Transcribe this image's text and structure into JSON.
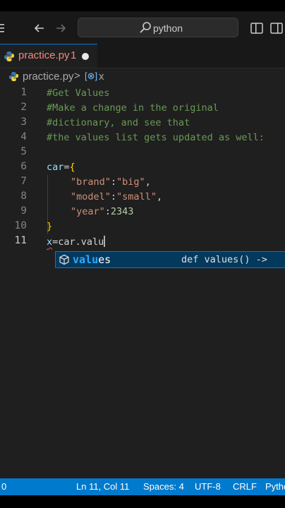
{
  "window": {
    "search_text": "python"
  },
  "tabs": [
    {
      "name": "practice.py",
      "problems": "1"
    }
  ],
  "breadcrumb": {
    "file": "practice.py",
    "separator": ">",
    "symbol_icon": "[⊗]",
    "symbol": "x"
  },
  "editor": {
    "line_numbers": [
      "1",
      "2",
      "3",
      "4",
      "5",
      "6",
      "7",
      "8",
      "9",
      "10",
      "11"
    ],
    "lines": {
      "l1": "#Get Values",
      "l2": "#Make a change in the original",
      "l3": "#dictionary, and see that",
      "l4": "#the values list gets updated as well:",
      "l6_var": "car",
      "l6_eq": "=",
      "l6_brace": "{",
      "l7_key": "\"brand\"",
      "l7_colon": ":",
      "l7_val": "\"big\"",
      "l7_comma": ",",
      "l8_key": "\"model\"",
      "l8_colon": ":",
      "l8_val": "\"small\"",
      "l8_comma": ",",
      "l9_key": "\"year\"",
      "l9_colon": ":",
      "l9_val": "2343",
      "l10_brace": "}",
      "l11_x": "x",
      "l11_rest": "=car.valu"
    }
  },
  "suggestion": {
    "label_match": "valu",
    "label_rest": "es",
    "detail": "def values() ->"
  },
  "statusbar": {
    "errors": "0",
    "position": "Ln 11, Col 11",
    "spaces": "Spaces: 4",
    "encoding": "UTF-8",
    "eol": "CRLF",
    "language": "Python"
  },
  "colors": {
    "accent": "#007acc",
    "tab_error": "#f1897f",
    "comment": "#6a9955",
    "string": "#ce9178",
    "number": "#b5cea8",
    "variable": "#9cdcfe",
    "bracket": "#ffd700"
  },
  "icons": [
    "menu-icon",
    "back-arrow-icon",
    "forward-arrow-icon",
    "search-icon",
    "split-editor-icon",
    "layout-icon",
    "python-file-icon",
    "method-icon"
  ]
}
